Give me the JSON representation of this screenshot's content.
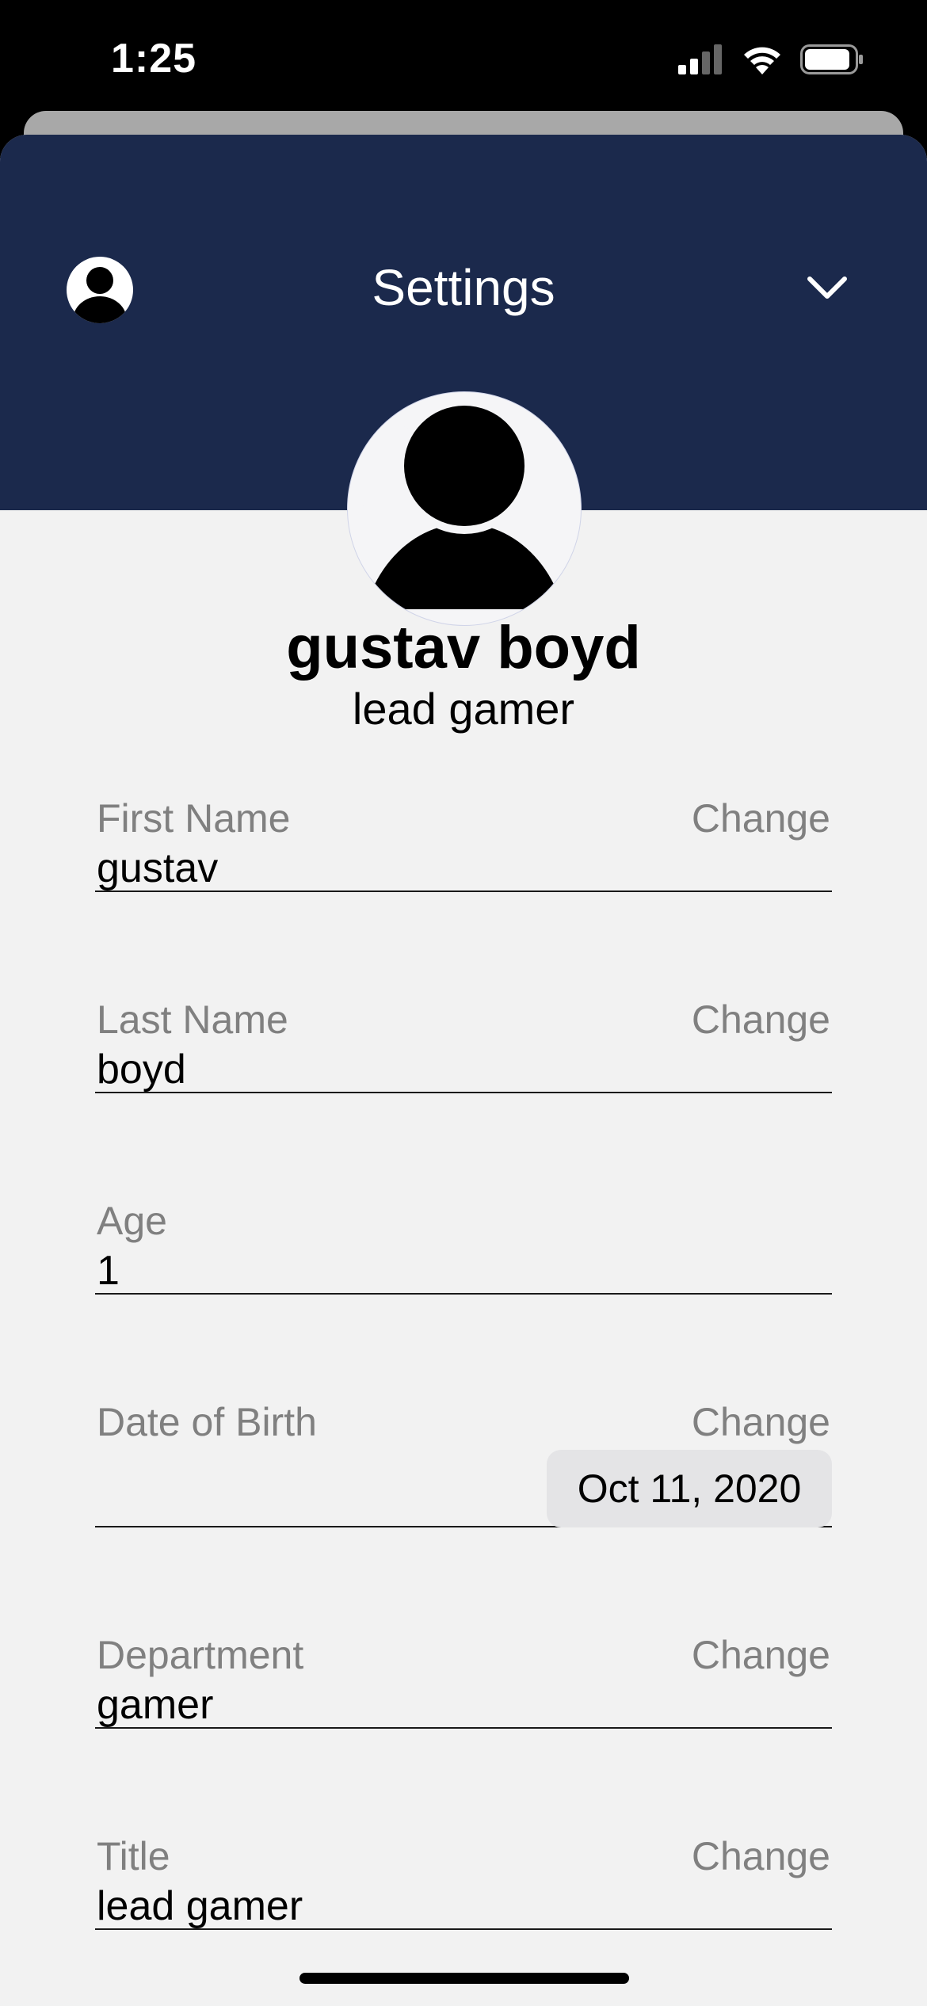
{
  "status_bar": {
    "time": "1:25",
    "icons": [
      "cellular-signal-icon",
      "wifi-icon",
      "battery-icon"
    ]
  },
  "header": {
    "title": "Settings",
    "left_icon": "user-avatar-icon",
    "right_icon": "chevron-down-icon",
    "background_color": "#1b294c"
  },
  "profile": {
    "name": "gustav boyd",
    "title": "lead gamer"
  },
  "fields": [
    {
      "label": "First Name",
      "value": "gustav",
      "action": "Change"
    },
    {
      "label": "Last Name",
      "value": "boyd",
      "action": "Change"
    },
    {
      "label": "Age",
      "value": "1"
    },
    {
      "label": "Date of Birth",
      "value": "Oct 11, 2020",
      "action": "Change"
    },
    {
      "label": "Department",
      "value": "gamer",
      "action": "Change"
    },
    {
      "label": "Title",
      "value": "lead gamer",
      "action": "Change"
    }
  ]
}
